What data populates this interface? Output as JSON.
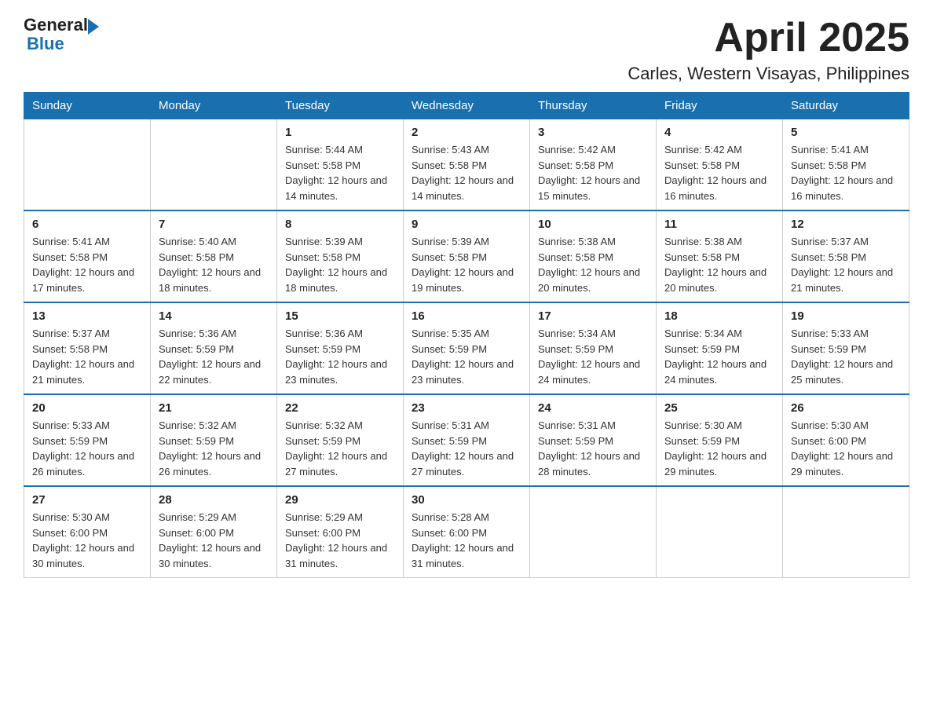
{
  "logo": {
    "text_general": "General",
    "text_blue": "Blue"
  },
  "header": {
    "month_title": "April 2025",
    "location": "Carles, Western Visayas, Philippines"
  },
  "weekdays": [
    "Sunday",
    "Monday",
    "Tuesday",
    "Wednesday",
    "Thursday",
    "Friday",
    "Saturday"
  ],
  "weeks": [
    [
      {
        "day": "",
        "sunrise": "",
        "sunset": "",
        "daylight": ""
      },
      {
        "day": "",
        "sunrise": "",
        "sunset": "",
        "daylight": ""
      },
      {
        "day": "1",
        "sunrise": "Sunrise: 5:44 AM",
        "sunset": "Sunset: 5:58 PM",
        "daylight": "Daylight: 12 hours and 14 minutes."
      },
      {
        "day": "2",
        "sunrise": "Sunrise: 5:43 AM",
        "sunset": "Sunset: 5:58 PM",
        "daylight": "Daylight: 12 hours and 14 minutes."
      },
      {
        "day": "3",
        "sunrise": "Sunrise: 5:42 AM",
        "sunset": "Sunset: 5:58 PM",
        "daylight": "Daylight: 12 hours and 15 minutes."
      },
      {
        "day": "4",
        "sunrise": "Sunrise: 5:42 AM",
        "sunset": "Sunset: 5:58 PM",
        "daylight": "Daylight: 12 hours and 16 minutes."
      },
      {
        "day": "5",
        "sunrise": "Sunrise: 5:41 AM",
        "sunset": "Sunset: 5:58 PM",
        "daylight": "Daylight: 12 hours and 16 minutes."
      }
    ],
    [
      {
        "day": "6",
        "sunrise": "Sunrise: 5:41 AM",
        "sunset": "Sunset: 5:58 PM",
        "daylight": "Daylight: 12 hours and 17 minutes."
      },
      {
        "day": "7",
        "sunrise": "Sunrise: 5:40 AM",
        "sunset": "Sunset: 5:58 PM",
        "daylight": "Daylight: 12 hours and 18 minutes."
      },
      {
        "day": "8",
        "sunrise": "Sunrise: 5:39 AM",
        "sunset": "Sunset: 5:58 PM",
        "daylight": "Daylight: 12 hours and 18 minutes."
      },
      {
        "day": "9",
        "sunrise": "Sunrise: 5:39 AM",
        "sunset": "Sunset: 5:58 PM",
        "daylight": "Daylight: 12 hours and 19 minutes."
      },
      {
        "day": "10",
        "sunrise": "Sunrise: 5:38 AM",
        "sunset": "Sunset: 5:58 PM",
        "daylight": "Daylight: 12 hours and 20 minutes."
      },
      {
        "day": "11",
        "sunrise": "Sunrise: 5:38 AM",
        "sunset": "Sunset: 5:58 PM",
        "daylight": "Daylight: 12 hours and 20 minutes."
      },
      {
        "day": "12",
        "sunrise": "Sunrise: 5:37 AM",
        "sunset": "Sunset: 5:58 PM",
        "daylight": "Daylight: 12 hours and 21 minutes."
      }
    ],
    [
      {
        "day": "13",
        "sunrise": "Sunrise: 5:37 AM",
        "sunset": "Sunset: 5:58 PM",
        "daylight": "Daylight: 12 hours and 21 minutes."
      },
      {
        "day": "14",
        "sunrise": "Sunrise: 5:36 AM",
        "sunset": "Sunset: 5:59 PM",
        "daylight": "Daylight: 12 hours and 22 minutes."
      },
      {
        "day": "15",
        "sunrise": "Sunrise: 5:36 AM",
        "sunset": "Sunset: 5:59 PM",
        "daylight": "Daylight: 12 hours and 23 minutes."
      },
      {
        "day": "16",
        "sunrise": "Sunrise: 5:35 AM",
        "sunset": "Sunset: 5:59 PM",
        "daylight": "Daylight: 12 hours and 23 minutes."
      },
      {
        "day": "17",
        "sunrise": "Sunrise: 5:34 AM",
        "sunset": "Sunset: 5:59 PM",
        "daylight": "Daylight: 12 hours and 24 minutes."
      },
      {
        "day": "18",
        "sunrise": "Sunrise: 5:34 AM",
        "sunset": "Sunset: 5:59 PM",
        "daylight": "Daylight: 12 hours and 24 minutes."
      },
      {
        "day": "19",
        "sunrise": "Sunrise: 5:33 AM",
        "sunset": "Sunset: 5:59 PM",
        "daylight": "Daylight: 12 hours and 25 minutes."
      }
    ],
    [
      {
        "day": "20",
        "sunrise": "Sunrise: 5:33 AM",
        "sunset": "Sunset: 5:59 PM",
        "daylight": "Daylight: 12 hours and 26 minutes."
      },
      {
        "day": "21",
        "sunrise": "Sunrise: 5:32 AM",
        "sunset": "Sunset: 5:59 PM",
        "daylight": "Daylight: 12 hours and 26 minutes."
      },
      {
        "day": "22",
        "sunrise": "Sunrise: 5:32 AM",
        "sunset": "Sunset: 5:59 PM",
        "daylight": "Daylight: 12 hours and 27 minutes."
      },
      {
        "day": "23",
        "sunrise": "Sunrise: 5:31 AM",
        "sunset": "Sunset: 5:59 PM",
        "daylight": "Daylight: 12 hours and 27 minutes."
      },
      {
        "day": "24",
        "sunrise": "Sunrise: 5:31 AM",
        "sunset": "Sunset: 5:59 PM",
        "daylight": "Daylight: 12 hours and 28 minutes."
      },
      {
        "day": "25",
        "sunrise": "Sunrise: 5:30 AM",
        "sunset": "Sunset: 5:59 PM",
        "daylight": "Daylight: 12 hours and 29 minutes."
      },
      {
        "day": "26",
        "sunrise": "Sunrise: 5:30 AM",
        "sunset": "Sunset: 6:00 PM",
        "daylight": "Daylight: 12 hours and 29 minutes."
      }
    ],
    [
      {
        "day": "27",
        "sunrise": "Sunrise: 5:30 AM",
        "sunset": "Sunset: 6:00 PM",
        "daylight": "Daylight: 12 hours and 30 minutes."
      },
      {
        "day": "28",
        "sunrise": "Sunrise: 5:29 AM",
        "sunset": "Sunset: 6:00 PM",
        "daylight": "Daylight: 12 hours and 30 minutes."
      },
      {
        "day": "29",
        "sunrise": "Sunrise: 5:29 AM",
        "sunset": "Sunset: 6:00 PM",
        "daylight": "Daylight: 12 hours and 31 minutes."
      },
      {
        "day": "30",
        "sunrise": "Sunrise: 5:28 AM",
        "sunset": "Sunset: 6:00 PM",
        "daylight": "Daylight: 12 hours and 31 minutes."
      },
      {
        "day": "",
        "sunrise": "",
        "sunset": "",
        "daylight": ""
      },
      {
        "day": "",
        "sunrise": "",
        "sunset": "",
        "daylight": ""
      },
      {
        "day": "",
        "sunrise": "",
        "sunset": "",
        "daylight": ""
      }
    ]
  ]
}
